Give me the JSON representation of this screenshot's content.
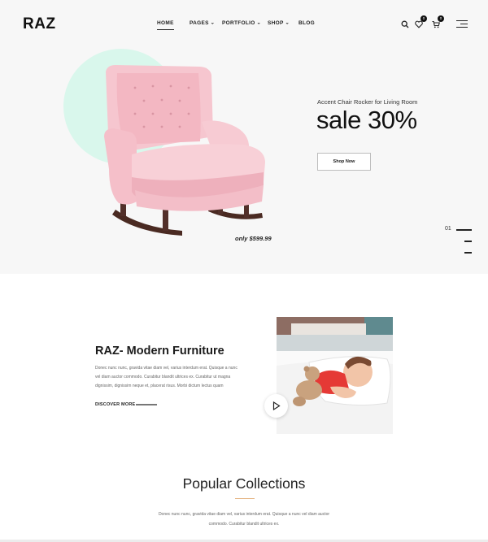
{
  "header": {
    "logo": "RAZ",
    "nav": [
      {
        "label": "HOME",
        "has_dropdown": false,
        "active": true
      },
      {
        "label": "PAGES",
        "has_dropdown": true
      },
      {
        "label": "PORTFOLIO",
        "has_dropdown": true
      },
      {
        "label": "SHOP",
        "has_dropdown": true
      },
      {
        "label": "BLOG",
        "has_dropdown": false
      }
    ],
    "icons": [
      "search-icon",
      "heart-icon",
      "cart-icon",
      "menu-icon"
    ],
    "wishlist_count": "0",
    "cart_count": "0"
  },
  "hero": {
    "subtitle": "Accent Chair Rocker for Living Room",
    "title": "sale 30%",
    "button_label": "Shop Now",
    "price": "only $599.99",
    "slide_number": "01",
    "colors": {
      "accent_circle": "#d9f7ec",
      "chair": "#f6c6cf",
      "background": "#f7f7f7"
    }
  },
  "about": {
    "title": "RAZ- Modern Furniture",
    "text": "Donec nunc nunc, gravida vitae diam vel, varius interdum erat. Quisque a nunc vel diam auctor commodo. Curabitur blandit ultrices ex. Curabitur ut magna dignissim, dignissim neque et, placerat risus. Morbi dictum lectus quam",
    "link_label": "DISCOVER MORE"
  },
  "collections": {
    "title": "Popular Collections",
    "text_line1": "Donec nunc nunc, gravida vitae diam vel, varius interdum erat. Quisque a nunc vel diam auctor",
    "text_line2": "commodo. Curabitur blandit ultrices ex.",
    "accent_color": "#e6b98a"
  }
}
